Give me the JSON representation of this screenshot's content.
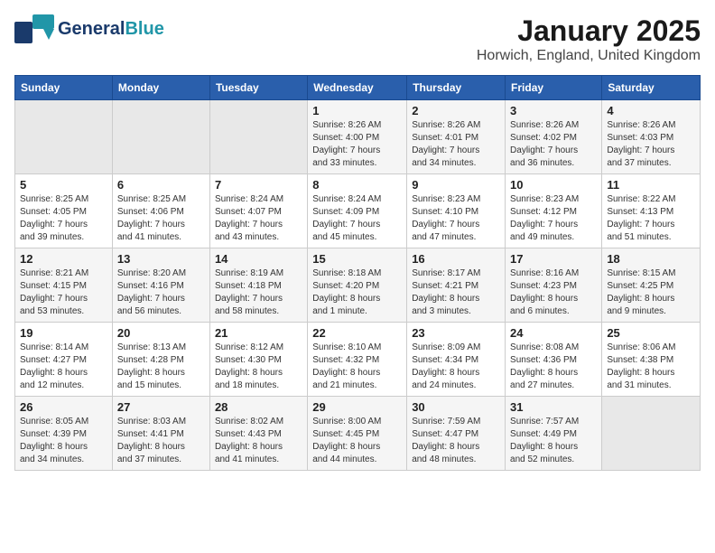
{
  "header": {
    "logo_line1": "General",
    "logo_line2": "Blue",
    "title": "January 2025",
    "subtitle": "Horwich, England, United Kingdom"
  },
  "days_of_week": [
    "Sunday",
    "Monday",
    "Tuesday",
    "Wednesday",
    "Thursday",
    "Friday",
    "Saturday"
  ],
  "weeks": [
    [
      {
        "day": "",
        "info": ""
      },
      {
        "day": "",
        "info": ""
      },
      {
        "day": "",
        "info": ""
      },
      {
        "day": "1",
        "info": "Sunrise: 8:26 AM\nSunset: 4:00 PM\nDaylight: 7 hours\nand 33 minutes."
      },
      {
        "day": "2",
        "info": "Sunrise: 8:26 AM\nSunset: 4:01 PM\nDaylight: 7 hours\nand 34 minutes."
      },
      {
        "day": "3",
        "info": "Sunrise: 8:26 AM\nSunset: 4:02 PM\nDaylight: 7 hours\nand 36 minutes."
      },
      {
        "day": "4",
        "info": "Sunrise: 8:26 AM\nSunset: 4:03 PM\nDaylight: 7 hours\nand 37 minutes."
      }
    ],
    [
      {
        "day": "5",
        "info": "Sunrise: 8:25 AM\nSunset: 4:05 PM\nDaylight: 7 hours\nand 39 minutes."
      },
      {
        "day": "6",
        "info": "Sunrise: 8:25 AM\nSunset: 4:06 PM\nDaylight: 7 hours\nand 41 minutes."
      },
      {
        "day": "7",
        "info": "Sunrise: 8:24 AM\nSunset: 4:07 PM\nDaylight: 7 hours\nand 43 minutes."
      },
      {
        "day": "8",
        "info": "Sunrise: 8:24 AM\nSunset: 4:09 PM\nDaylight: 7 hours\nand 45 minutes."
      },
      {
        "day": "9",
        "info": "Sunrise: 8:23 AM\nSunset: 4:10 PM\nDaylight: 7 hours\nand 47 minutes."
      },
      {
        "day": "10",
        "info": "Sunrise: 8:23 AM\nSunset: 4:12 PM\nDaylight: 7 hours\nand 49 minutes."
      },
      {
        "day": "11",
        "info": "Sunrise: 8:22 AM\nSunset: 4:13 PM\nDaylight: 7 hours\nand 51 minutes."
      }
    ],
    [
      {
        "day": "12",
        "info": "Sunrise: 8:21 AM\nSunset: 4:15 PM\nDaylight: 7 hours\nand 53 minutes."
      },
      {
        "day": "13",
        "info": "Sunrise: 8:20 AM\nSunset: 4:16 PM\nDaylight: 7 hours\nand 56 minutes."
      },
      {
        "day": "14",
        "info": "Sunrise: 8:19 AM\nSunset: 4:18 PM\nDaylight: 7 hours\nand 58 minutes."
      },
      {
        "day": "15",
        "info": "Sunrise: 8:18 AM\nSunset: 4:20 PM\nDaylight: 8 hours\nand 1 minute."
      },
      {
        "day": "16",
        "info": "Sunrise: 8:17 AM\nSunset: 4:21 PM\nDaylight: 8 hours\nand 3 minutes."
      },
      {
        "day": "17",
        "info": "Sunrise: 8:16 AM\nSunset: 4:23 PM\nDaylight: 8 hours\nand 6 minutes."
      },
      {
        "day": "18",
        "info": "Sunrise: 8:15 AM\nSunset: 4:25 PM\nDaylight: 8 hours\nand 9 minutes."
      }
    ],
    [
      {
        "day": "19",
        "info": "Sunrise: 8:14 AM\nSunset: 4:27 PM\nDaylight: 8 hours\nand 12 minutes."
      },
      {
        "day": "20",
        "info": "Sunrise: 8:13 AM\nSunset: 4:28 PM\nDaylight: 8 hours\nand 15 minutes."
      },
      {
        "day": "21",
        "info": "Sunrise: 8:12 AM\nSunset: 4:30 PM\nDaylight: 8 hours\nand 18 minutes."
      },
      {
        "day": "22",
        "info": "Sunrise: 8:10 AM\nSunset: 4:32 PM\nDaylight: 8 hours\nand 21 minutes."
      },
      {
        "day": "23",
        "info": "Sunrise: 8:09 AM\nSunset: 4:34 PM\nDaylight: 8 hours\nand 24 minutes."
      },
      {
        "day": "24",
        "info": "Sunrise: 8:08 AM\nSunset: 4:36 PM\nDaylight: 8 hours\nand 27 minutes."
      },
      {
        "day": "25",
        "info": "Sunrise: 8:06 AM\nSunset: 4:38 PM\nDaylight: 8 hours\nand 31 minutes."
      }
    ],
    [
      {
        "day": "26",
        "info": "Sunrise: 8:05 AM\nSunset: 4:39 PM\nDaylight: 8 hours\nand 34 minutes."
      },
      {
        "day": "27",
        "info": "Sunrise: 8:03 AM\nSunset: 4:41 PM\nDaylight: 8 hours\nand 37 minutes."
      },
      {
        "day": "28",
        "info": "Sunrise: 8:02 AM\nSunset: 4:43 PM\nDaylight: 8 hours\nand 41 minutes."
      },
      {
        "day": "29",
        "info": "Sunrise: 8:00 AM\nSunset: 4:45 PM\nDaylight: 8 hours\nand 44 minutes."
      },
      {
        "day": "30",
        "info": "Sunrise: 7:59 AM\nSunset: 4:47 PM\nDaylight: 8 hours\nand 48 minutes."
      },
      {
        "day": "31",
        "info": "Sunrise: 7:57 AM\nSunset: 4:49 PM\nDaylight: 8 hours\nand 52 minutes."
      },
      {
        "day": "",
        "info": ""
      }
    ]
  ]
}
